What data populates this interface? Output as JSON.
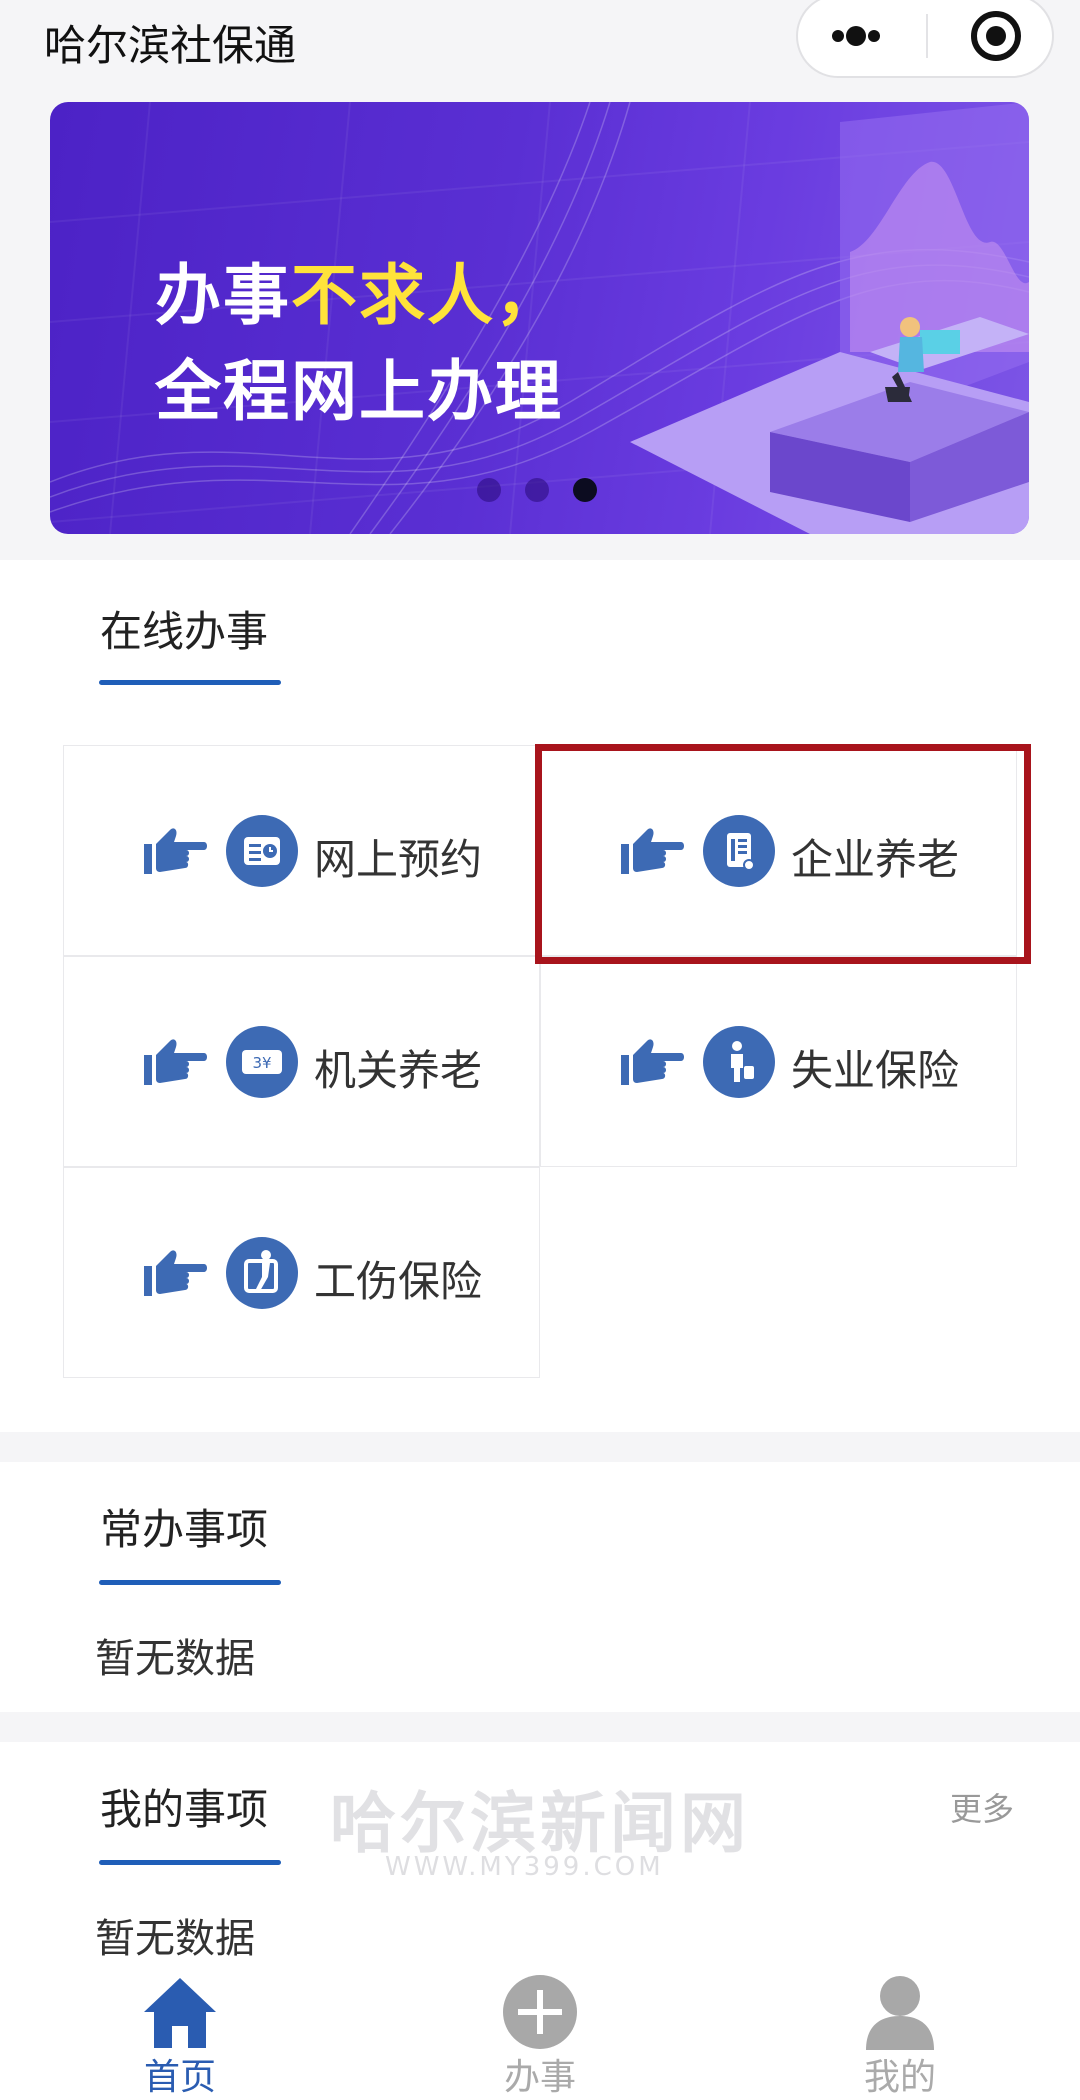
{
  "header": {
    "title": "哈尔滨社保通",
    "more_icon": "more-dots-icon",
    "close_icon": "target-icon"
  },
  "banner": {
    "line1_a": "办事",
    "line1_b": "不求人，",
    "line2": "全程网上办理",
    "slides": 3,
    "active_slide": 3
  },
  "online": {
    "title": "在线办事",
    "items": [
      {
        "label": "网上预约",
        "icon": "appointment-icon"
      },
      {
        "label": "企业养老",
        "icon": "enterprise-pension-icon"
      },
      {
        "label": "机关养老",
        "icon": "government-pension-icon"
      },
      {
        "label": "失业保险",
        "icon": "unemployment-insurance-icon"
      },
      {
        "label": "工伤保险",
        "icon": "work-injury-insurance-icon"
      }
    ]
  },
  "common": {
    "title": "常办事项",
    "empty": "暂无数据"
  },
  "mine": {
    "title": "我的事项",
    "more": "更多",
    "empty": "暂无数据"
  },
  "watermark": {
    "main": "哈尔滨新闻网",
    "sub": "WWW.MY399.COM"
  },
  "tabbar": [
    {
      "label": "首页",
      "icon": "home-icon",
      "active": true
    },
    {
      "label": "办事",
      "icon": "plus-icon",
      "active": false
    },
    {
      "label": "我的",
      "icon": "user-icon",
      "active": false
    }
  ],
  "colors": {
    "accent": "#1f5eb8",
    "icon_blue": "#3d6ab4",
    "highlight": "#a8141c",
    "banner_yellow": "#ffe33a"
  }
}
